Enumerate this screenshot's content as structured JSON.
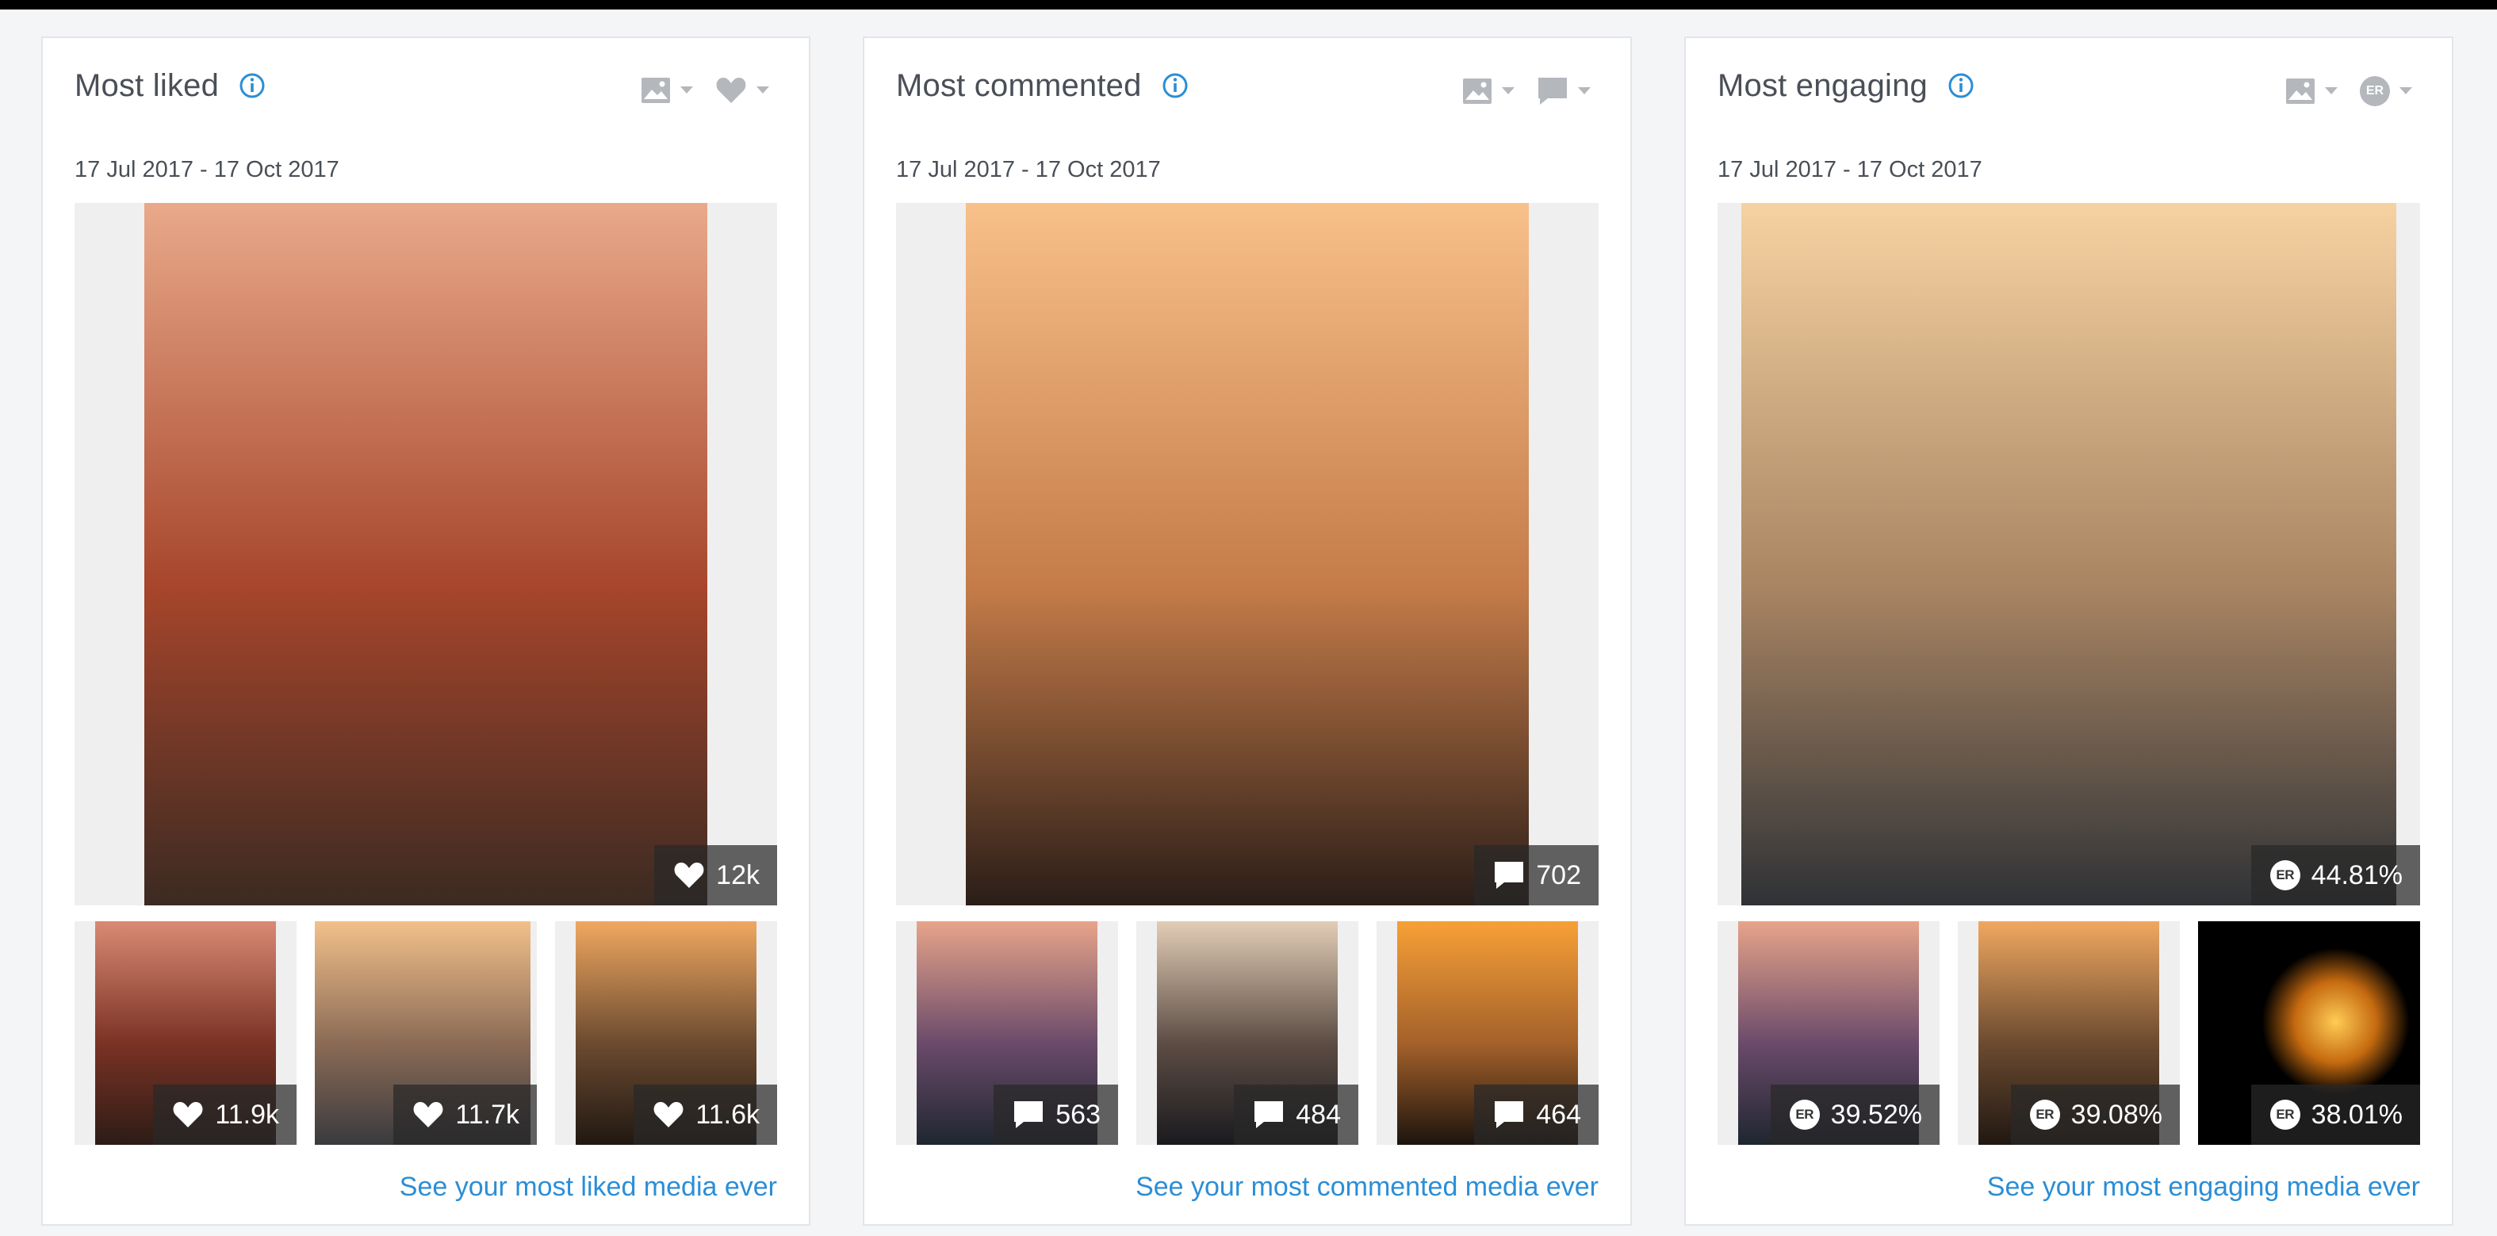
{
  "cards": [
    {
      "title": "Most liked",
      "date_range": "17 Jul 2017 - 17 Oct 2017",
      "hero": {
        "metric": "12k",
        "metric_icon": "heart-icon",
        "palette": [
          "#e9a98a",
          "#a6452b",
          "#3b2a22"
        ]
      },
      "thumbs": [
        {
          "metric": "11.9k",
          "metric_icon": "heart-icon",
          "palette": [
            "#d98a74",
            "#7a3224",
            "#2c1c16"
          ]
        },
        {
          "metric": "11.7k",
          "metric_icon": "heart-icon",
          "palette": [
            "#f2c08a",
            "#8a6a55",
            "#3a3a3e"
          ]
        },
        {
          "metric": "11.6k",
          "metric_icon": "heart-icon",
          "palette": [
            "#f0a860",
            "#6b4a30",
            "#201812"
          ]
        }
      ],
      "link": "See your most liked media ever",
      "controls": [
        "image-icon",
        "heart-icon"
      ]
    },
    {
      "title": "Most commented",
      "date_range": "17 Jul 2017 - 17 Oct 2017",
      "hero": {
        "metric": "702",
        "metric_icon": "comment-icon",
        "palette": [
          "#f8c08a",
          "#c47b48",
          "#2a1d18"
        ]
      },
      "thumbs": [
        {
          "metric": "563",
          "metric_icon": "comment-icon",
          "palette": [
            "#e7a48a",
            "#6a4a6a",
            "#1f2630"
          ]
        },
        {
          "metric": "484",
          "metric_icon": "comment-icon",
          "palette": [
            "#e2cdb6",
            "#5c4c44",
            "#1a1a1e"
          ]
        },
        {
          "metric": "464",
          "metric_icon": "comment-icon",
          "palette": [
            "#f7a036",
            "#a3602a",
            "#1c140e"
          ]
        }
      ],
      "link": "See your most commented media ever",
      "controls": [
        "image-icon",
        "comment-icon"
      ]
    },
    {
      "title": "Most engaging",
      "date_range": "17 Jul 2017 - 17 Oct 2017",
      "hero": {
        "metric": "44.81%",
        "metric_icon": "er-icon",
        "palette": [
          "#f6d2a2",
          "#a88462",
          "#2f3236"
        ]
      },
      "thumbs": [
        {
          "metric": "39.52%",
          "metric_icon": "er-icon",
          "palette": [
            "#e7a48a",
            "#6a4a6a",
            "#1f2630"
          ]
        },
        {
          "metric": "39.08%",
          "metric_icon": "er-icon",
          "palette": [
            "#f0a860",
            "#6b4a30",
            "#201812"
          ]
        },
        {
          "metric": "38.01%",
          "metric_icon": "er-icon",
          "palette": [
            "#ffcc55",
            "#c56a10",
            "#000000"
          ]
        }
      ],
      "link": "See your most engaging media ever",
      "controls": [
        "image-icon",
        "er-icon"
      ]
    }
  ],
  "er_label": "ER",
  "colors": {
    "accent": "#2b8ed6",
    "title": "#4a4f57",
    "control_gray": "#b4b7bc",
    "badge_bg": "rgba(40,40,40,0.72)"
  }
}
